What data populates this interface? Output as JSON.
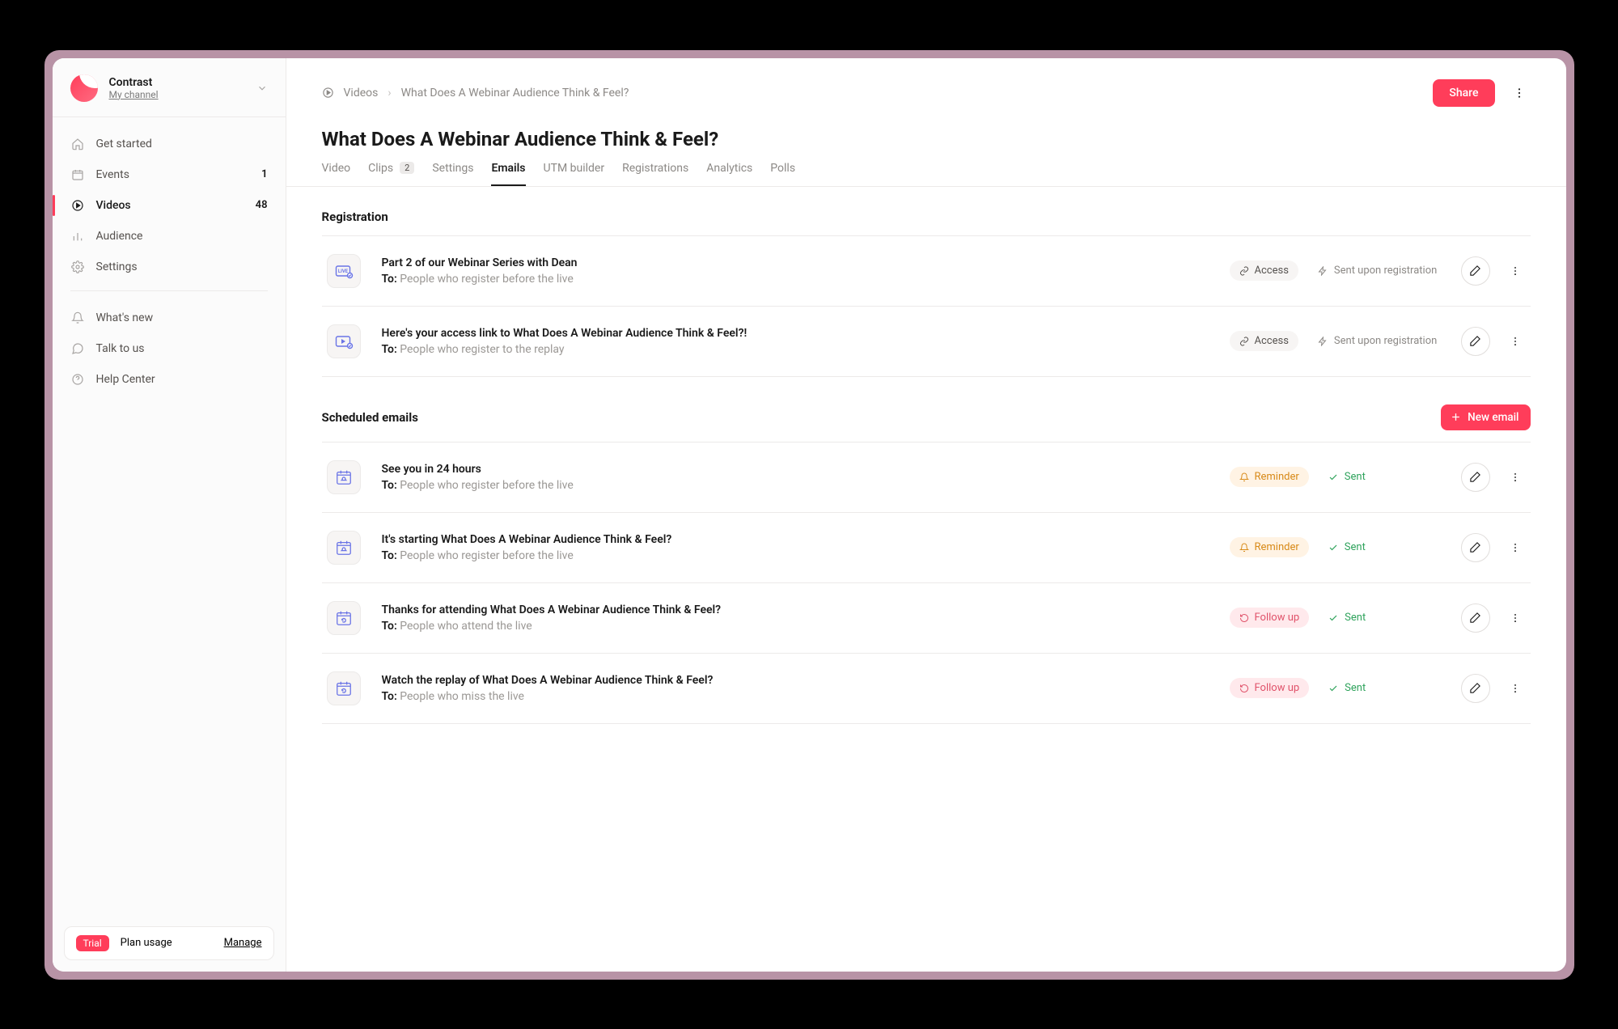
{
  "sidebar": {
    "brand": "Contrast",
    "subtitle": "My channel",
    "nav": [
      {
        "label": "Get started",
        "count": ""
      },
      {
        "label": "Events",
        "count": "1"
      },
      {
        "label": "Videos",
        "count": "48"
      },
      {
        "label": "Audience",
        "count": ""
      },
      {
        "label": "Settings",
        "count": ""
      }
    ],
    "secondary": [
      {
        "label": "What's new"
      },
      {
        "label": "Talk to us"
      },
      {
        "label": "Help Center"
      }
    ],
    "plan": {
      "badge": "Trial",
      "label": "Plan usage",
      "manage": "Manage"
    }
  },
  "breadcrumb": {
    "root": "Videos",
    "current": "What Does A Webinar Audience Think & Feel?"
  },
  "header": {
    "title": "What Does A Webinar Audience Think & Feel?",
    "share": "Share"
  },
  "tabs": [
    {
      "label": "Video"
    },
    {
      "label": "Clips",
      "badge": "2"
    },
    {
      "label": "Settings"
    },
    {
      "label": "Emails"
    },
    {
      "label": "UTM builder"
    },
    {
      "label": "Registrations"
    },
    {
      "label": "Analytics"
    },
    {
      "label": "Polls"
    }
  ],
  "sections": {
    "registration": {
      "title": "Registration",
      "rows": [
        {
          "title": "Part 2 of our Webinar Series with Dean",
          "to_prefix": "To:",
          "to": "People who register before the live",
          "badge": "Access",
          "status": "Sent upon registration"
        },
        {
          "title": "Here's your access link to What Does A Webinar Audience Think & Feel?!",
          "to_prefix": "To:",
          "to": "People who register to the replay",
          "badge": "Access",
          "status": "Sent upon registration"
        }
      ]
    },
    "scheduled": {
      "title": "Scheduled emails",
      "new_label": "New email",
      "rows": [
        {
          "title": "See you in 24 hours",
          "to_prefix": "To:",
          "to": "People who register before the live",
          "badge": "Reminder",
          "badge_type": "reminder",
          "status": "Sent"
        },
        {
          "title": "It's starting What Does A Webinar Audience Think & Feel?",
          "to_prefix": "To:",
          "to": "People who register before the live",
          "badge": "Reminder",
          "badge_type": "reminder",
          "status": "Sent"
        },
        {
          "title": "Thanks for attending What Does A Webinar Audience Think & Feel?",
          "to_prefix": "To:",
          "to": "People who attend the live",
          "badge": "Follow up",
          "badge_type": "follow",
          "status": "Sent"
        },
        {
          "title": "Watch the replay of What Does A Webinar Audience Think & Feel?",
          "to_prefix": "To:",
          "to": "People who miss the live",
          "badge": "Follow up",
          "badge_type": "follow",
          "status": "Sent"
        }
      ]
    }
  }
}
